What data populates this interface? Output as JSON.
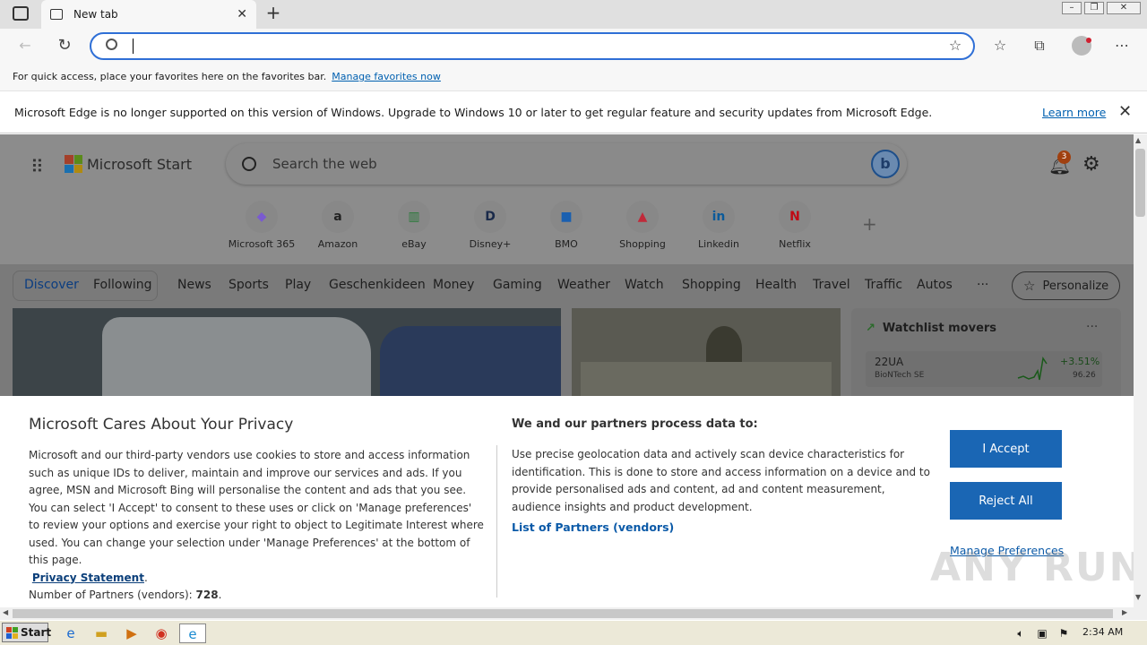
{
  "browser": {
    "tab_title": "New tab",
    "tab_close": "✕",
    "new_tab": "+",
    "favbar_text": "For quick access, place your favorites here on the favorites bar.",
    "favbar_link": "Manage favorites now",
    "info_text": "Microsoft Edge is no longer supported on this version of Windows. Upgrade to Windows 10 or later to get regular feature and security updates from Microsoft Edge.",
    "info_link": "Learn more"
  },
  "start_page": {
    "brand": "Microsoft Start",
    "search_placeholder": "Search the web",
    "notification_count": "3",
    "quick_links": [
      {
        "label": "Microsoft 365",
        "glyph": "◆",
        "color": "#7a5ad0"
      },
      {
        "label": "Amazon",
        "glyph": "a",
        "color": "#222"
      },
      {
        "label": "eBay",
        "glyph": "▥",
        "color": "#2a7a3a"
      },
      {
        "label": "Disney+",
        "glyph": "D",
        "color": "#1a2a4a"
      },
      {
        "label": "BMO",
        "glyph": "■",
        "color": "#1a60b0"
      },
      {
        "label": "Shopping",
        "glyph": "▲",
        "color": "#c02a3a"
      },
      {
        "label": "Linkedin",
        "glyph": "in",
        "color": "#0a5a9a"
      },
      {
        "label": "Netflix",
        "glyph": "N",
        "color": "#c00a14"
      }
    ],
    "nav": {
      "discover": "Discover",
      "following": "Following",
      "items": [
        "News",
        "Sports",
        "Play",
        "Geschenkideen",
        "Money",
        "Gaming",
        "Weather",
        "Watch",
        "Shopping",
        "Health",
        "Travel",
        "Traffic",
        "Autos"
      ],
      "more": "···",
      "personalize": "Personalize"
    },
    "watchlist": {
      "title": "Watchlist movers",
      "more": "···",
      "symbol": "22UA",
      "company": "BioNTech SE",
      "change": "+3.51%",
      "price": "96.26"
    }
  },
  "privacy": {
    "title": "Microsoft Cares About Your Privacy",
    "body": "Microsoft and our third-party vendors use cookies to store and access information such as unique IDs to deliver, maintain and improve our services and ads. If you agree, MSN and Microsoft Bing will personalise the content and ads that you see. You can select 'I Accept' to consent to these uses or click on 'Manage preferences' to review your options and exercise your right to object to Legitimate Interest where used.  You can change your selection under 'Manage Preferences' at the bottom of this page.",
    "privacy_link": "Privacy Statement",
    "partners_label": "Number of Partners (vendors):",
    "partners_count": "728",
    "heading2": "We and our partners process data to:",
    "body2": "Use precise geolocation data and actively scan device characteristics for identification. This is done to store and access information on a device and to provide personalised ads and content, ad and content measurement, audience insights and product development.",
    "partners_link": "List of Partners (vendors)",
    "accept": "I Accept",
    "reject": "Reject All",
    "manage": "Manage Preferences"
  },
  "taskbar": {
    "start": "Start",
    "clock": "2:34 AM"
  },
  "watermark": "ANY RUN"
}
